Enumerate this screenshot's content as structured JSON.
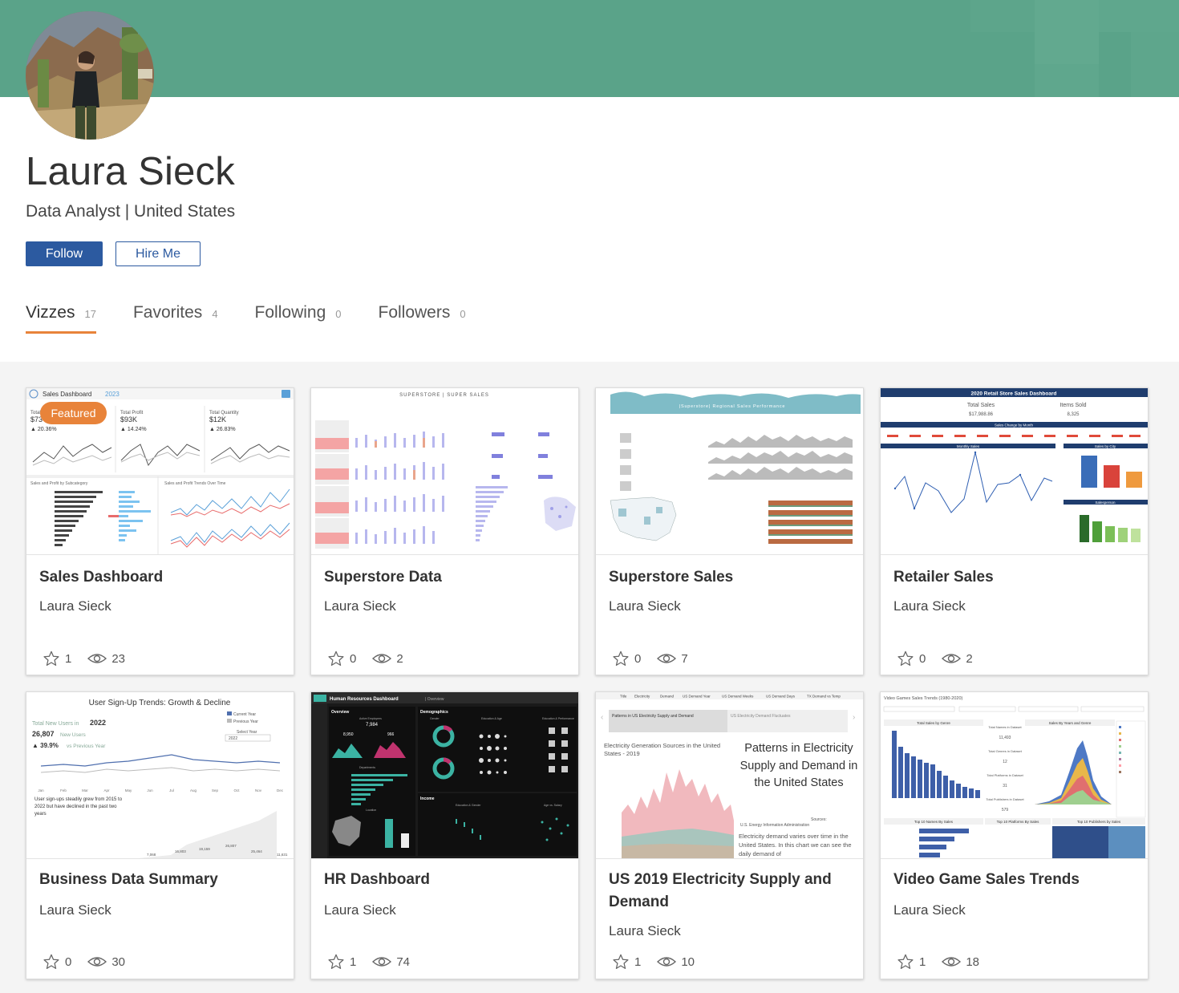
{
  "profile": {
    "name": "Laura Sieck",
    "subtitle": "Data Analyst | United States",
    "follow_label": "Follow",
    "hire_label": "Hire Me"
  },
  "tabs": [
    {
      "label": "Vizzes",
      "count": "17"
    },
    {
      "label": "Favorites",
      "count": "4"
    },
    {
      "label": "Following",
      "count": "0"
    },
    {
      "label": "Followers",
      "count": "0"
    }
  ],
  "colors": {
    "banner": "#5aa389",
    "accent": "#e8833a",
    "primary": "#2c5aa0"
  },
  "featured_badge": "Featured",
  "cards": [
    {
      "title": "Sales Dashboard",
      "author": "Laura Sieck",
      "favorites": "1",
      "views": "23"
    },
    {
      "title": "Superstore Data",
      "author": "Laura Sieck",
      "favorites": "0",
      "views": "2"
    },
    {
      "title": "Superstore Sales",
      "author": "Laura Sieck",
      "favorites": "0",
      "views": "7"
    },
    {
      "title": "Retailer Sales",
      "author": "Laura Sieck",
      "favorites": "0",
      "views": "2"
    },
    {
      "title": "Business Data Summary",
      "author": "Laura Sieck",
      "favorites": "0",
      "views": "30"
    },
    {
      "title": "HR Dashboard",
      "author": "Laura Sieck",
      "favorites": "1",
      "views": "74"
    },
    {
      "title": "US 2019 Electricity Supply and Demand",
      "author": "Laura Sieck",
      "favorites": "1",
      "views": "10"
    },
    {
      "title": "Video Game Sales Trends",
      "author": "Laura Sieck",
      "favorites": "1",
      "views": "18"
    }
  ],
  "thumbs": {
    "t1": {
      "title": "Sales Dashboard",
      "year": "2023",
      "k1": "Total Sales",
      "k1v": "$73",
      "k1d": "▲ 20.36%",
      "k2": "Total Profit",
      "k2v": "$93K",
      "k2d": "▲ 14.24%",
      "k3": "Total Quantity",
      "k3v": "$12K",
      "k3d": "▲ 26.83%",
      "vs": "vs. Previous Year",
      "s1": "Sales and Profit by Subcategory",
      "s2": "Sales and Profit Trends Over Time"
    },
    "t2": {
      "title": "SUPERSTORE | SUPER SALES"
    },
    "t3": {
      "title": "|Superstore| Regional Sales Performance"
    },
    "t4": {
      "title": "2020 Retail Store Sales Dashboard",
      "k1": "Total Sales",
      "k1v": "$17,988.86",
      "k2": "Items Sold",
      "k2v": "8,325",
      "s1": "Sales Change by Month",
      "s2": "Monthly Sales",
      "s3": "Sales by City",
      "s4": "Salesperson"
    },
    "t5": {
      "title": "User Sign-Up Trends: Growth & Decline",
      "l1": "Total New Users in",
      "year": "2022",
      "v1": "26,807",
      "v1s": "New Users",
      "d1": "▲ 39.9%",
      "d1s": "vs Previous Year",
      "leg1": "Current Year",
      "leg2": "Previous Year",
      "sel": "Select Year",
      "selv": "2022",
      "note": "User sign-ups steadily grew from 2015 to 2022 but have declined in the past two years",
      "a1": "7,068",
      "a2": "16,803",
      "a3": "19,159",
      "a4": "26,807",
      "a5": "25,464",
      "a6": "11,631",
      "months": [
        "Jan",
        "Feb",
        "Mar",
        "Apr",
        "May",
        "Jun",
        "Jul",
        "Aug",
        "Sep",
        "Oct",
        "Nov",
        "Dec"
      ]
    },
    "t6": {
      "title": "Human Resources Dashboard",
      "sub": "| Overview",
      "p1": "Overview",
      "p2": "Demographics",
      "p3": "Income",
      "active": "Active Employees",
      "v1": "8,950",
      "v2": "966",
      "v3": "7,984",
      "hired": "Hired",
      "term": "Terminated",
      "dept": "Departments",
      "loc": "Location",
      "gender": "Gender",
      "edu": "Education & Age",
      "perf": "Education & Performance",
      "inc": "Education & Gender",
      "age": "Age vs. Salary"
    },
    "t7": {
      "tabs": [
        "Title",
        "Electricity",
        "Demand",
        "US Demand Year",
        "US Demand Weeks",
        "US Demand Days",
        "TX Demand vs Temp"
      ],
      "cap1": "Patterns in US Electricity Supply and Demand",
      "cap2": "US Electricity Demand Fluctuates",
      "chart": "Electricity Generation Sources in the United States - 2019",
      "heading": "Patterns in Electricity Supply and Demand in the United States",
      "src": "Sources:",
      "srcv": "U.S. Energy Information Administration",
      "body": "Electricity demand varies over time in the United States. In this chart we can see the daily demand of"
    },
    "t8": {
      "title": "Video Games Sales Trends (1980-2020)",
      "s1": "Total Sales by Genre",
      "s2": "Sales By Years and Genre",
      "s3": "Top 10 Names By Sales",
      "s4": "Top 10 Platforms By Sales",
      "s5": "Top 10 Publishers by Sales",
      "k1": "Total Names in Dataset",
      "k1v": "11,493",
      "k2": "Total Genres in Dataset",
      "k2v": "12",
      "k3": "Total Platforms in Dataset",
      "k3v": "31",
      "k4": "Total Publishers in Dataset",
      "k4v": "579"
    }
  }
}
